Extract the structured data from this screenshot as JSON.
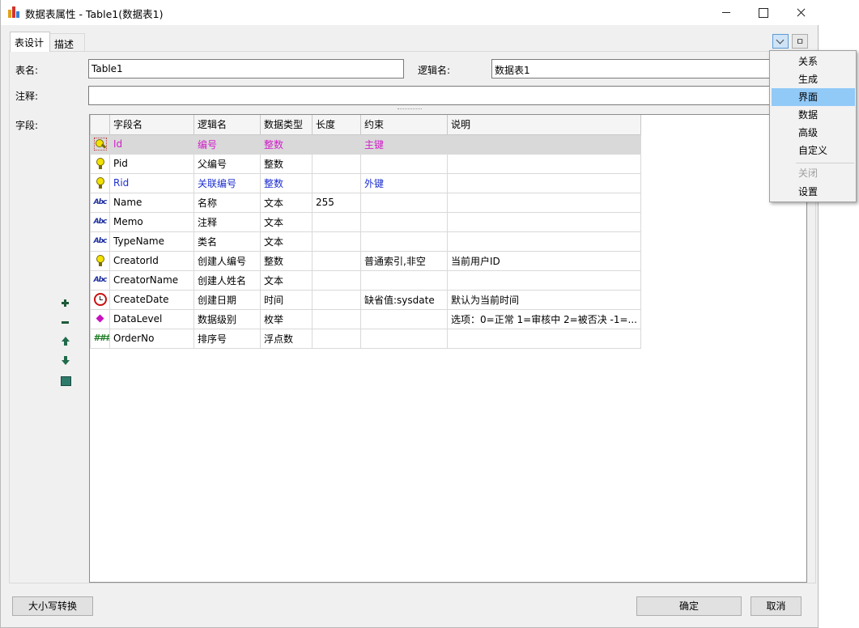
{
  "window": {
    "title": "数据表属性 - Table1(数据表1)"
  },
  "tabs": [
    {
      "label": "表设计"
    },
    {
      "label": "描述"
    }
  ],
  "form": {
    "table_name_label": "表名:",
    "table_name_value": "Table1",
    "logical_name_label": "逻辑名:",
    "logical_name_value": "数据表1",
    "comment_label": "注释:",
    "comment_value": "",
    "fields_label": "字段:"
  },
  "grid": {
    "columns": [
      "字段名",
      "逻辑名",
      "数据类型",
      "长度",
      "约束",
      "说明"
    ],
    "rows": [
      {
        "icon": "primary-key-icon",
        "name": "Id",
        "logical": "编号",
        "type": "整数",
        "length": "",
        "constraint": "主键",
        "desc": ""
      },
      {
        "icon": "key-icon",
        "name": "Pid",
        "logical": "父编号",
        "type": "整数",
        "length": "",
        "constraint": "",
        "desc": ""
      },
      {
        "icon": "key-icon",
        "name": "Rid",
        "logical": "关联编号",
        "type": "整数",
        "length": "",
        "constraint": "外键",
        "desc": ""
      },
      {
        "icon": "text-type-icon",
        "name": "Name",
        "logical": "名称",
        "type": "文本",
        "length": "255",
        "constraint": "",
        "desc": ""
      },
      {
        "icon": "text-type-icon",
        "name": "Memo",
        "logical": "注释",
        "type": "文本",
        "length": "",
        "constraint": "",
        "desc": ""
      },
      {
        "icon": "text-type-icon",
        "name": "TypeName",
        "logical": "类名",
        "type": "文本",
        "length": "",
        "constraint": "",
        "desc": ""
      },
      {
        "icon": "key-icon",
        "name": "CreatorId",
        "logical": "创建人编号",
        "type": "整数",
        "length": "",
        "constraint": "普通索引,非空",
        "desc": "当前用户ID"
      },
      {
        "icon": "text-type-icon",
        "name": "CreatorName",
        "logical": "创建人姓名",
        "type": "文本",
        "length": "",
        "constraint": "",
        "desc": ""
      },
      {
        "icon": "clock-icon",
        "name": "CreateDate",
        "logical": "创建日期",
        "type": "时间",
        "length": "",
        "constraint": "缺省值:sysdate",
        "desc": "默认为当前时间"
      },
      {
        "icon": "enum-icon",
        "name": "DataLevel",
        "logical": "数据级别",
        "type": "枚举",
        "length": "",
        "constraint": "",
        "desc": "选项：0=正常 1=审核中 2=被否决 -1=..."
      },
      {
        "icon": "float-type-icon",
        "name": "OrderNo",
        "logical": "排序号",
        "type": "浮点数",
        "length": "",
        "constraint": "",
        "desc": ""
      }
    ]
  },
  "menu": {
    "items": [
      {
        "label": "关系"
      },
      {
        "label": "生成"
      },
      {
        "label": "界面"
      },
      {
        "label": "数据"
      },
      {
        "label": "高级"
      },
      {
        "label": "自定义"
      },
      {
        "label": "关闭"
      },
      {
        "label": "设置"
      }
    ],
    "highlighted": "界面",
    "disabled": "关闭"
  },
  "footer": {
    "case_convert_label": "大小写转换",
    "ok_label": "确定",
    "cancel_label": "取消"
  },
  "pin_glyph": "ㅁ",
  "colors": {
    "primary_key_text": "#d020c8",
    "foreign_key_text": "#1d2fd0",
    "menu_highlight": "#91c9f7"
  }
}
